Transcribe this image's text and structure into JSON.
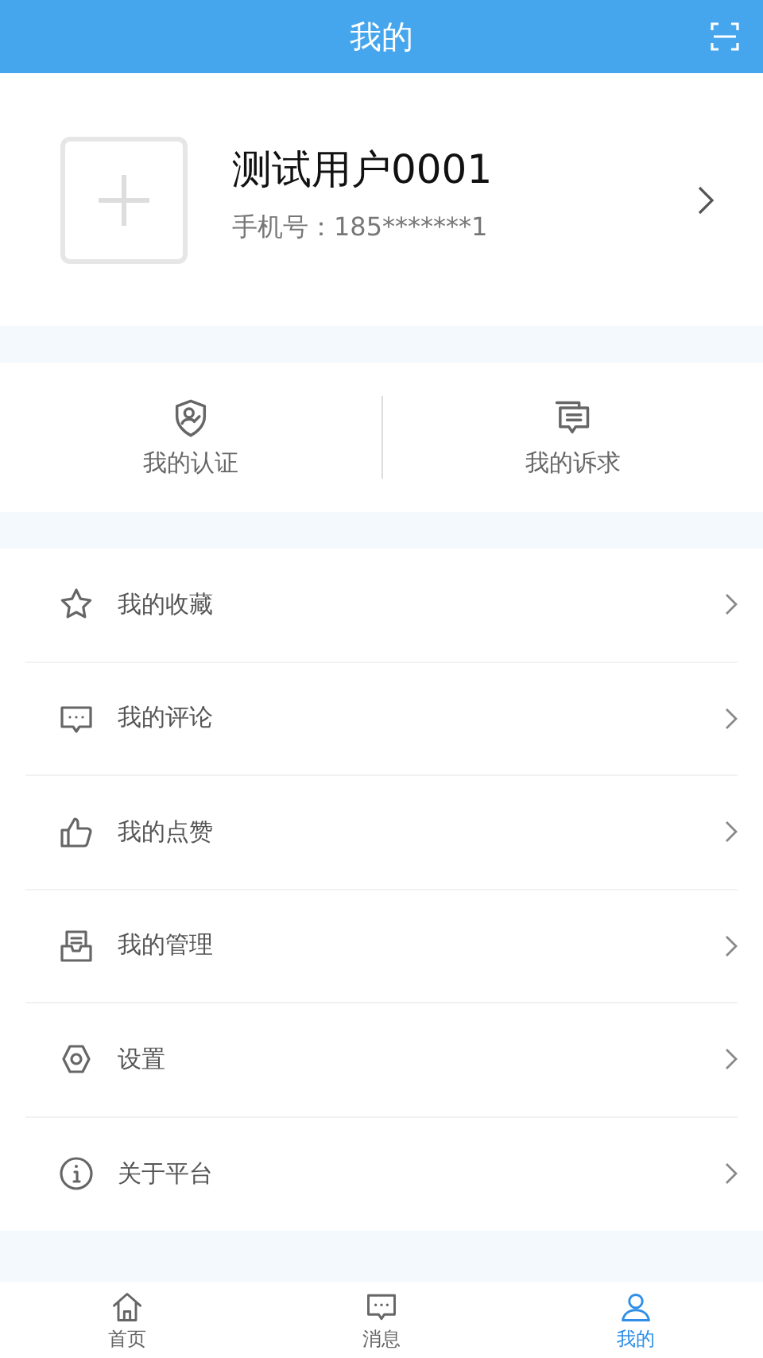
{
  "header": {
    "title": "我的"
  },
  "profile": {
    "name": "测试用户0001",
    "phone_label": "手机号：",
    "phone": "185*******1"
  },
  "quick_actions": [
    {
      "kind": "shield",
      "label": "我的认证"
    },
    {
      "kind": "messages",
      "label": "我的诉求"
    }
  ],
  "menu": [
    {
      "kind": "star",
      "label": "我的收藏"
    },
    {
      "kind": "comment",
      "label": "我的评论"
    },
    {
      "kind": "like",
      "label": "我的点赞"
    },
    {
      "kind": "tray",
      "label": "我的管理"
    },
    {
      "kind": "gear",
      "label": "设置"
    },
    {
      "kind": "info",
      "label": "关于平台"
    }
  ],
  "tab_bar": [
    {
      "kind": "home",
      "label": "首页",
      "selected": false
    },
    {
      "kind": "chat",
      "label": "消息",
      "selected": false
    },
    {
      "kind": "person",
      "label": "我的",
      "selected": true
    }
  ]
}
